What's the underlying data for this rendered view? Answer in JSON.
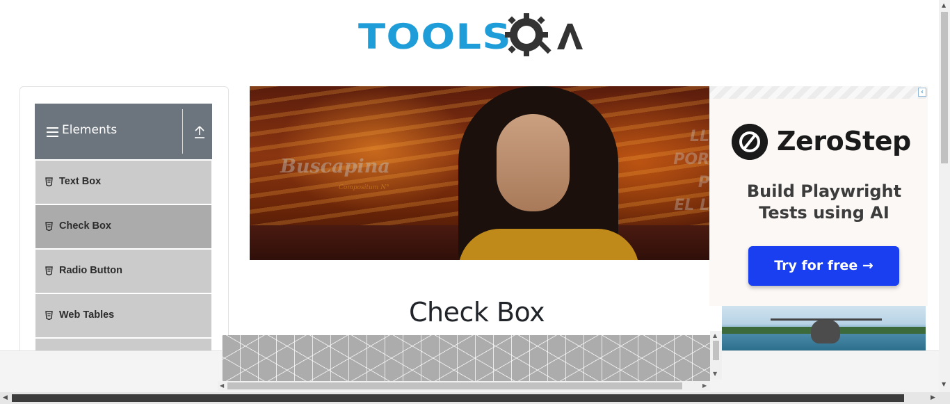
{
  "header": {
    "logo_text": "TOOLS",
    "logo_suffix": "QA"
  },
  "sidebar": {
    "group_title": "Elements",
    "items": [
      {
        "label": "Text Box",
        "active": false
      },
      {
        "label": "Check Box",
        "active": true
      },
      {
        "label": "Radio Button",
        "active": false
      },
      {
        "label": "Web Tables",
        "active": false
      }
    ]
  },
  "video_ad": {
    "brand": "Buscapina",
    "brand_sub": "Compositum N°",
    "side_text": [
      "LL",
      "POR",
      "P",
      "EL L"
    ]
  },
  "right_ad": {
    "close_label": "‹",
    "brand_name": "ZeroStep",
    "tagline_line1": "Build Playwright",
    "tagline_line2": "Tests using AI",
    "cta_label": "Try for free →"
  },
  "main": {
    "page_title": "Check Box"
  },
  "colors": {
    "logo_blue": "#1e9dd8",
    "logo_dark": "#333333",
    "sidebar_header": "#6c757d",
    "menu_item_bg": "#cbcbcb",
    "menu_item_active": "#ababab",
    "cta_blue": "#1a3ff0"
  },
  "icons": {
    "hamburger": "menu-icon",
    "upload": "upload-icon",
    "menu_item": "document-icon",
    "gear": "gear-icon"
  }
}
